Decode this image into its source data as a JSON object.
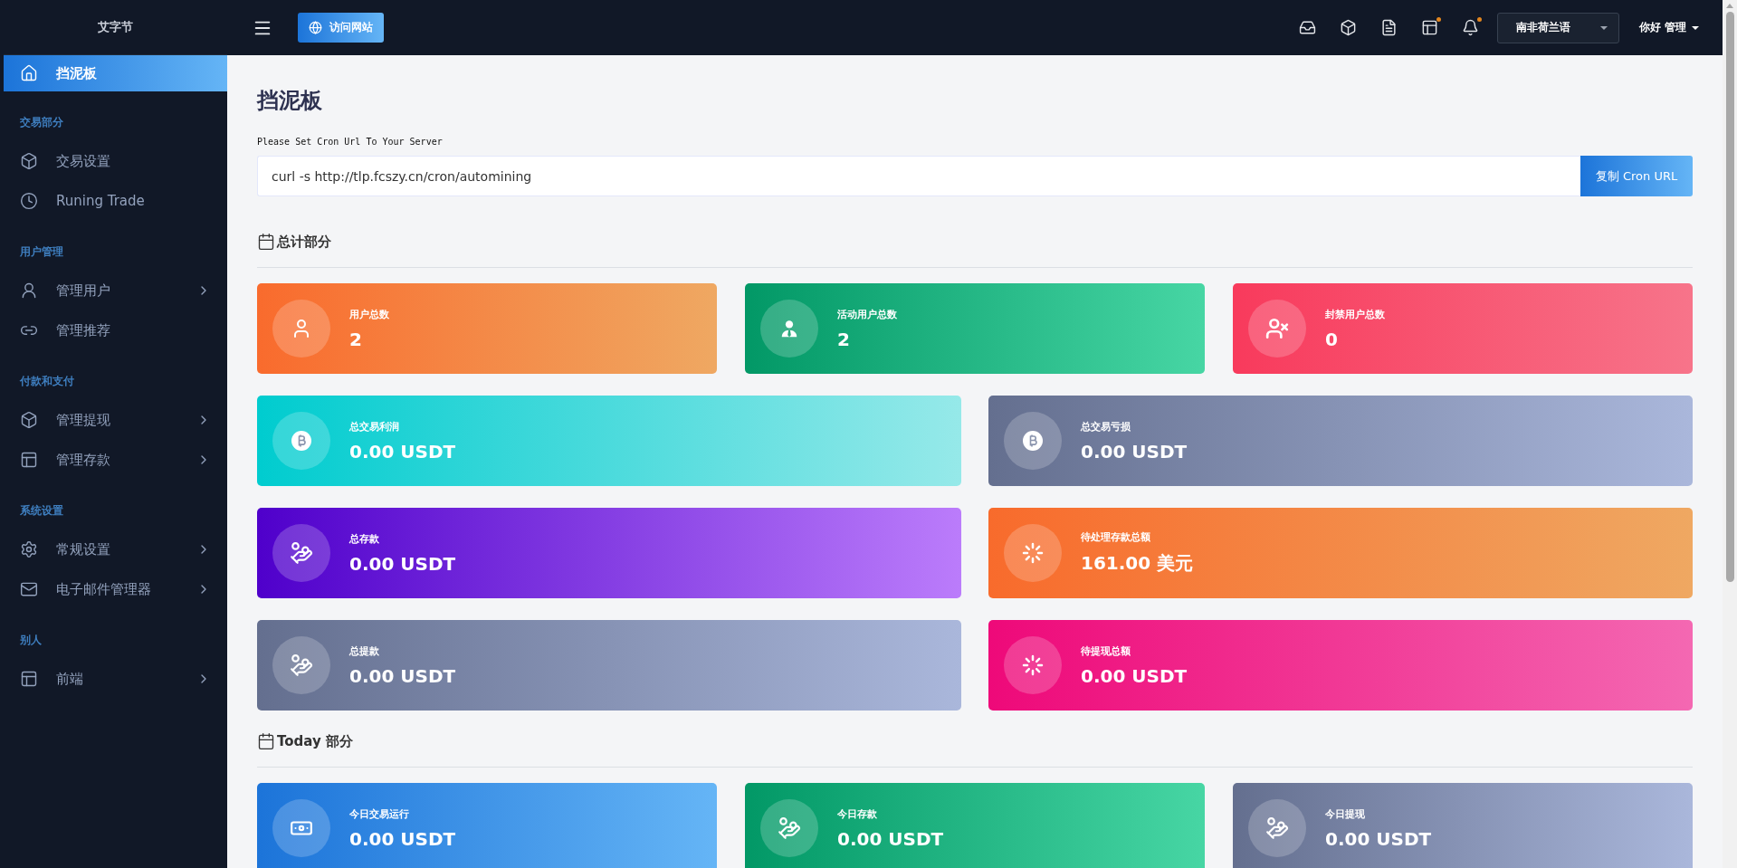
{
  "sidebar": {
    "brand": "艾字节",
    "groups": [
      {
        "items": [
          {
            "label": "挡泥板",
            "kind": "home",
            "submenu": false,
            "selected": true
          }
        ]
      },
      {
        "heading": "交易部分",
        "items": [
          {
            "label": "交易设置",
            "kind": "box",
            "submenu": false,
            "selected": false
          },
          {
            "label": "Runing Trade",
            "kind": "clock",
            "submenu": false,
            "selected": false
          }
        ]
      },
      {
        "heading": "用户管理",
        "items": [
          {
            "label": "管理用户",
            "kind": "user",
            "submenu": true,
            "selected": false
          },
          {
            "label": "管理推荐",
            "kind": "link",
            "submenu": false,
            "selected": false
          }
        ]
      },
      {
        "heading": "付款和支付",
        "items": [
          {
            "label": "管理提现",
            "kind": "box",
            "submenu": true,
            "selected": false
          },
          {
            "label": "管理存款",
            "kind": "layout",
            "submenu": true,
            "selected": false
          }
        ]
      },
      {
        "heading": "系统设置",
        "items": [
          {
            "label": "常规设置",
            "kind": "gear",
            "submenu": true,
            "selected": false
          },
          {
            "label": "电子邮件管理器",
            "kind": "mail",
            "submenu": true,
            "selected": false
          }
        ]
      },
      {
        "heading": "别人",
        "items": [
          {
            "label": "前端",
            "kind": "layout",
            "submenu": true,
            "selected": false
          }
        ]
      }
    ]
  },
  "topbar": {
    "visit_button": "访问网站",
    "icons": [
      {
        "kind": "inbox",
        "badge": false
      },
      {
        "kind": "box",
        "badge": false
      },
      {
        "kind": "file",
        "badge": false
      },
      {
        "kind": "layout",
        "badge": true
      },
      {
        "kind": "bell",
        "badge": true
      }
    ],
    "language": "南非荷兰语",
    "user": "你好 管理"
  },
  "page": {
    "title": "挡泥板",
    "cron_hint": "Please Set Cron Url To Your Server",
    "cron_value": "curl -s http://tlp.fcszy.cn/cron/automining",
    "copy_button": "复制 Cron URL"
  },
  "sections": [
    {
      "heading": "总计部分",
      "rows": [
        [
          {
            "label": "用户总数",
            "value": "2",
            "kind": "user",
            "color": "#f96b2d"
          },
          {
            "label": "活动用户总数",
            "value": "2",
            "kind": "user-tie",
            "color": "#029866"
          },
          {
            "label": "封禁用户总数",
            "value": "0",
            "kind": "user-x",
            "color": "#f83a5c"
          }
        ],
        [
          {
            "label": "总交易利润",
            "value": "0.00 USDT",
            "kind": "bitcoin",
            "color": "#00cccf"
          },
          {
            "label": "总交易亏损",
            "value": "0.00 USDT",
            "kind": "bitcoin",
            "color": "#646f8f"
          }
        ],
        [
          {
            "label": "总存款",
            "value": "0.00 USDT",
            "kind": "hand-dollar",
            "color": "#4f00cb"
          },
          {
            "label": "待处理存款总额",
            "value": "161.00 美元",
            "kind": "spinner",
            "color": "#f86b2c"
          }
        ],
        [
          {
            "label": "总提款",
            "value": "0.00 USDT",
            "kind": "hand-dollar",
            "color": "#646f8f"
          },
          {
            "label": "待提现总额",
            "value": "0.00 USDT",
            "kind": "spinner",
            "color": "#ee0979"
          }
        ]
      ]
    },
    {
      "heading": "Today 部分",
      "rows": [
        [
          {
            "label": "今日交易运行",
            "value": "0.00 USDT",
            "kind": "money",
            "color": "#1c74d9"
          },
          {
            "label": "今日存款",
            "value": "0.00 USDT",
            "kind": "hand-dollar",
            "color": "#029866"
          },
          {
            "label": "今日提现",
            "value": "0.00 USDT",
            "kind": "hand-dollar",
            "color": "#646f8f"
          }
        ]
      ]
    }
  ]
}
